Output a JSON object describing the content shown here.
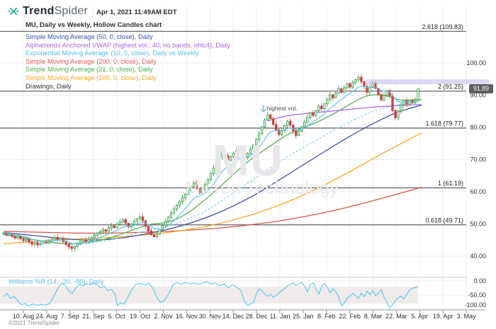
{
  "header": {
    "logo_trend": "Trend",
    "logo_spider": "Spider",
    "timestamp": "Apr 1, 2021 11:49AM EDT",
    "subtitle": "MU, Daily vs Weekly, Hollow Candles chart"
  },
  "legend": {
    "items": [
      {
        "label": "Simple Moving Average (50, 0, close), Daily",
        "color": "#3f51a8"
      },
      {
        "label": "Alphatrends Anchored VWAP (highest vol., 40, no bands, ohlc4), Daily",
        "color": "#a866dd"
      },
      {
        "label": "Exponential Moving Average (10, 0, close), Daily vs Weekly",
        "color": "#55bfe5"
      },
      {
        "label": "Simple Moving Average (200, 0, close), Daily",
        "color": "#e05c5c"
      },
      {
        "label": "Simple Moving Average (21, 0, close), Daily",
        "color": "#55aa55"
      },
      {
        "label": "Simple Moving Average (100, 0, close), Daily",
        "color": "#f5a623"
      },
      {
        "label": "Drawings, Daily",
        "color": "#333338"
      }
    ]
  },
  "annotation": {
    "icon": "⚓",
    "label": "highest vol."
  },
  "watermark": {
    "line1": "MU",
    "line2": "Micron Technology"
  },
  "price_badge": "91.89",
  "copyright": "©2021 TrendSpider",
  "chart_data": {
    "type": "candlestick",
    "symbol": "MU",
    "title": "MU, Daily vs Weekly, Hollow Candles chart",
    "last_price": 91.89,
    "price_axis": {
      "ticks": [
        "100.00",
        "90.00",
        "80.00",
        "70.00",
        "60.00",
        "50.00",
        "40.00"
      ],
      "values": [
        100,
        90,
        80,
        70,
        60,
        50,
        40
      ]
    },
    "x_axis": {
      "labels": [
        "10. Aug",
        "24. Aug",
        "7. Sep",
        "21. Sep",
        "5. Oct",
        "19. Oct",
        "2. Nov",
        "16. Nov",
        "30. Nov",
        "14. Dec",
        "28. Dec",
        "11. Jan",
        "25. Jan",
        "8. Feb",
        "22. Feb",
        "8. Mar",
        "22. Mar",
        "5. Apr",
        "19. Apr",
        "3. May"
      ]
    },
    "fib_levels": [
      {
        "label": "2.618 (109.83)",
        "price": 109.83
      },
      {
        "label": "2 (91.25)",
        "price": 91.25
      },
      {
        "label": "1.618 (79.77)",
        "price": 79.77
      },
      {
        "label": "1 (61.19)",
        "price": 61.19
      },
      {
        "label": "0.618 (49.71)",
        "price": 49.71
      }
    ],
    "candle_up_color": "#36a14b",
    "candle_down_color": "#c94040",
    "candles_close": [
      47.2,
      46.5,
      46.9,
      46.1,
      45.6,
      46.2,
      45.4,
      44.8,
      45.2,
      44.3,
      43.7,
      44.2,
      43.5,
      43.9,
      44.6,
      44.1,
      44.7,
      45.3,
      45.8,
      45.0,
      45.5,
      44.5,
      43.6,
      42.9,
      42.4,
      43.0,
      43.7,
      44.4,
      45.0,
      44.5,
      45.1,
      45.8,
      46.5,
      47.2,
      47.6,
      48.2,
      47.7,
      48.8,
      49.4,
      48.8,
      49.9,
      50.6,
      51.3,
      50.2,
      49.1,
      49.9,
      50.8,
      51.6,
      52.2,
      51.0,
      49.3,
      47.8,
      46.6,
      46.0,
      46.9,
      48.2,
      49.5,
      50.8,
      52.1,
      53.4,
      54.6,
      55.8,
      56.9,
      58.1,
      59.2,
      60.4,
      61.6,
      62.8,
      61.0,
      59.6,
      60.8,
      62.2,
      63.8,
      65.6,
      67.4,
      69.2,
      71.0,
      72.4,
      71.2,
      69.8,
      70.9,
      71.9,
      72.8,
      73.6,
      72.0,
      70.7,
      71.9,
      73.2,
      74.5,
      76.2,
      78.0,
      80.1,
      82.3,
      83.9,
      82.7,
      80.9,
      79.2,
      77.8,
      79.0,
      80.5,
      81.9,
      80.7,
      78.9,
      77.5,
      78.8,
      80.2,
      81.6,
      83.0,
      84.5,
      83.7,
      85.2,
      86.6,
      85.8,
      87.3,
      88.7,
      90.1,
      89.2,
      90.6,
      92.0,
      90.9,
      92.3,
      93.6,
      92.5,
      93.9,
      94.8,
      95.6,
      94.2,
      92.7,
      90.9,
      92.4,
      93.7,
      92.1,
      90.2,
      88.5,
      90.0,
      91.4,
      89.8,
      85.2,
      83.0,
      85.1,
      87.0,
      88.4,
      87.2,
      88.5,
      87.6,
      88.4,
      91.89
    ],
    "ema_10_daily": {
      "name": "ema-10-daily",
      "color": "#5fc3e9"
    },
    "overlays": [
      {
        "name": "sma-200-daily",
        "color": "#d9534f",
        "dash": "",
        "points": [
          [
            5,
            47.7
          ],
          [
            60,
            47.4
          ],
          [
            120,
            47.1
          ],
          [
            180,
            47.2
          ],
          [
            240,
            47.7
          ],
          [
            300,
            48.5
          ],
          [
            360,
            49.8
          ],
          [
            420,
            51.8
          ],
          [
            480,
            54.5
          ],
          [
            540,
            58.0
          ],
          [
            595,
            61.4
          ]
        ]
      },
      {
        "name": "sma-100-daily",
        "color": "#f5a623",
        "dash": "",
        "points": [
          [
            5,
            43.8
          ],
          [
            60,
            44.8
          ],
          [
            120,
            45.4
          ],
          [
            180,
            46.1
          ],
          [
            240,
            47.3
          ],
          [
            300,
            49.5
          ],
          [
            360,
            53.0
          ],
          [
            420,
            58.0
          ],
          [
            480,
            64.5
          ],
          [
            540,
            72.0
          ],
          [
            595,
            78.3
          ]
        ]
      },
      {
        "name": "sma-50-daily",
        "color": "#3e4f96",
        "dash": "",
        "points": [
          [
            5,
            47.3
          ],
          [
            40,
            46.6
          ],
          [
            80,
            45.6
          ],
          [
            120,
            44.9
          ],
          [
            160,
            45.2
          ],
          [
            200,
            46.6
          ],
          [
            240,
            48.4
          ],
          [
            280,
            51.0
          ],
          [
            320,
            54.5
          ],
          [
            360,
            59.0
          ],
          [
            400,
            64.5
          ],
          [
            440,
            70.0
          ],
          [
            480,
            75.5
          ],
          [
            520,
            80.5
          ],
          [
            560,
            84.8
          ],
          [
            595,
            86.9
          ]
        ]
      },
      {
        "name": "ema-10-weekly",
        "color": "#8fd0ec",
        "dash": "3,2.5",
        "points": [
          [
            5,
            46.6
          ],
          [
            40,
            45.0
          ],
          [
            80,
            43.9
          ],
          [
            120,
            43.7
          ],
          [
            160,
            45.1
          ],
          [
            200,
            47.6
          ],
          [
            240,
            49.4
          ],
          [
            280,
            52.6
          ],
          [
            320,
            58.2
          ],
          [
            360,
            64.2
          ],
          [
            400,
            70.2
          ],
          [
            440,
            75.2
          ],
          [
            480,
            80.2
          ],
          [
            520,
            84.6
          ],
          [
            555,
            86.8
          ],
          [
            595,
            88.3
          ]
        ]
      },
      {
        "name": "sma-21-daily",
        "color": "#55aa55",
        "dash": "",
        "points": [
          [
            5,
            46.9
          ],
          [
            30,
            45.9
          ],
          [
            60,
            44.6
          ],
          [
            90,
            43.8
          ],
          [
            120,
            44.0
          ],
          [
            150,
            45.2
          ],
          [
            180,
            47.5
          ],
          [
            210,
            50.0
          ],
          [
            235,
            50.3
          ],
          [
            260,
            52.5
          ],
          [
            290,
            57.5
          ],
          [
            320,
            63.5
          ],
          [
            350,
            69.5
          ],
          [
            380,
            74.0
          ],
          [
            410,
            78.5
          ],
          [
            440,
            80.8
          ],
          [
            470,
            84.0
          ],
          [
            500,
            88.0
          ],
          [
            520,
            90.2
          ],
          [
            545,
            90.0
          ],
          [
            565,
            88.2
          ],
          [
            595,
            88.7
          ]
        ]
      },
      {
        "name": "anchored-vwap-highest-vol",
        "color": "#a866dd",
        "dash": "",
        "points": [
          [
            378,
            82.0
          ],
          [
            400,
            83.5
          ],
          [
            430,
            84.3
          ],
          [
            460,
            84.9
          ],
          [
            490,
            85.5
          ],
          [
            520,
            86.2
          ],
          [
            550,
            86.6
          ],
          [
            575,
            86.9
          ],
          [
            595,
            87.1
          ]
        ]
      }
    ],
    "drawing_band": {
      "price_top": 94.9,
      "price_bottom": 93.4,
      "color": "#b7b1e9"
    },
    "oscillator": {
      "name": "Williams %R (14, -20, -80), Daily",
      "color": "#5fc3e9",
      "axis_ticks": [
        "0.00",
        "-50.00",
        "-100.00"
      ],
      "axis_values": [
        0,
        -50,
        -100
      ],
      "overbought": -20,
      "oversold": -80,
      "band_color": "#ece8e6",
      "points": [
        [
          5,
          -55
        ],
        [
          10,
          -45
        ],
        [
          15,
          -62
        ],
        [
          20,
          -55
        ],
        [
          25,
          -70
        ],
        [
          30,
          -85
        ],
        [
          35,
          -80
        ],
        [
          40,
          -87
        ],
        [
          46,
          -82
        ],
        [
          52,
          -86
        ],
        [
          58,
          -83
        ],
        [
          64,
          -86
        ],
        [
          70,
          -80
        ],
        [
          76,
          -55
        ],
        [
          82,
          -25
        ],
        [
          87,
          -8
        ],
        [
          92,
          -15
        ],
        [
          97,
          -35
        ],
        [
          102,
          -45
        ],
        [
          107,
          -25
        ],
        [
          112,
          -12
        ],
        [
          117,
          -18
        ],
        [
          122,
          -10
        ],
        [
          127,
          -15
        ],
        [
          132,
          -8
        ],
        [
          137,
          -14
        ],
        [
          142,
          -25
        ],
        [
          147,
          -18
        ],
        [
          152,
          -35
        ],
        [
          157,
          -30
        ],
        [
          162,
          -45
        ],
        [
          166,
          -88
        ],
        [
          170,
          -78
        ],
        [
          175,
          -82
        ],
        [
          180,
          -60
        ],
        [
          186,
          -30
        ],
        [
          192,
          -12
        ],
        [
          198,
          -8
        ],
        [
          204,
          -16
        ],
        [
          210,
          -8
        ],
        [
          216,
          -28
        ],
        [
          222,
          -62
        ],
        [
          227,
          -76
        ],
        [
          232,
          -70
        ],
        [
          238,
          -45
        ],
        [
          244,
          -15
        ],
        [
          250,
          -6
        ],
        [
          256,
          -12
        ],
        [
          262,
          -5
        ],
        [
          268,
          -10
        ],
        [
          274,
          -7
        ],
        [
          280,
          -13
        ],
        [
          286,
          -7
        ],
        [
          292,
          -4
        ],
        [
          298,
          -11
        ],
        [
          304,
          -7
        ],
        [
          310,
          -17
        ],
        [
          316,
          -11
        ],
        [
          322,
          -24
        ],
        [
          328,
          -14
        ],
        [
          334,
          -22
        ],
        [
          340,
          -34
        ],
        [
          345,
          -72
        ],
        [
          350,
          -88
        ],
        [
          354,
          -80
        ],
        [
          358,
          -76
        ],
        [
          362,
          -45
        ],
        [
          366,
          -28
        ],
        [
          370,
          -36
        ],
        [
          374,
          -48
        ],
        [
          378,
          -54
        ],
        [
          382,
          -47
        ],
        [
          386,
          -58
        ],
        [
          390,
          -50
        ],
        [
          396,
          -38
        ],
        [
          402,
          -26
        ],
        [
          408,
          -14
        ],
        [
          414,
          -7
        ],
        [
          418,
          -17
        ],
        [
          422,
          -9
        ],
        [
          426,
          -5
        ],
        [
          430,
          -20
        ],
        [
          434,
          -38
        ],
        [
          438,
          -13
        ],
        [
          442,
          -7
        ],
        [
          446,
          -30
        ],
        [
          450,
          -46
        ],
        [
          454,
          -20
        ],
        [
          458,
          -9
        ],
        [
          462,
          -24
        ],
        [
          466,
          -42
        ],
        [
          470,
          -28
        ],
        [
          474,
          -38
        ],
        [
          478,
          -56
        ],
        [
          482,
          -88
        ],
        [
          486,
          -78
        ],
        [
          490,
          -60
        ],
        [
          494,
          -54
        ],
        [
          498,
          -44
        ],
        [
          502,
          -52
        ],
        [
          506,
          -62
        ],
        [
          510,
          -44
        ],
        [
          514,
          -56
        ],
        [
          518,
          -36
        ],
        [
          522,
          -48
        ],
        [
          526,
          -34
        ],
        [
          530,
          -52
        ],
        [
          534,
          -44
        ],
        [
          538,
          -30
        ],
        [
          542,
          -58
        ],
        [
          546,
          -74
        ],
        [
          550,
          -96
        ],
        [
          554,
          -84
        ],
        [
          558,
          -70
        ],
        [
          562,
          -60
        ],
        [
          566,
          -54
        ],
        [
          570,
          -64
        ],
        [
          574,
          -48
        ],
        [
          578,
          -32
        ],
        [
          582,
          -26
        ],
        [
          586,
          -24
        ],
        [
          590,
          -18
        ]
      ]
    }
  }
}
